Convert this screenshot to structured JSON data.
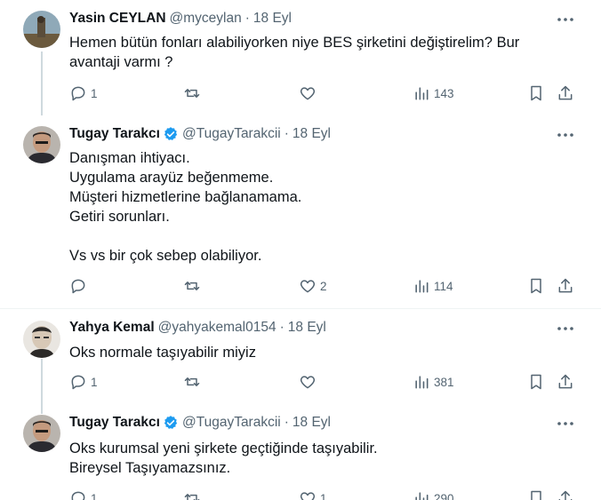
{
  "tweets": [
    {
      "name": "Yasin CEYLAN",
      "verified": false,
      "handle": "@myceylan",
      "date": "18 Eyl",
      "lines": [
        "Hemen bütün fonları alabiliyorken niye BES şirketini değiştirelim? Bur",
        "avantaji varmı ?"
      ],
      "replies": "1",
      "retweets": "",
      "likes": "",
      "views": "143"
    },
    {
      "name": "Tugay Tarakcı",
      "verified": true,
      "handle": "@TugayTarakcii",
      "date": "18 Eyl",
      "lines": [
        "Danışman ihtiyacı.",
        "Uygulama arayüz beğenmeme.",
        "Müşteri hizmetlerine bağlanamama.",
        "Getiri sorunları.",
        "",
        "Vs vs bir çok sebep olabiliyor."
      ],
      "replies": "",
      "retweets": "",
      "likes": "2",
      "views": "114"
    },
    {
      "name": "Yahya Kemal",
      "verified": false,
      "handle": "@yahyakemal0154",
      "date": "18 Eyl",
      "lines": [
        "Oks normale taşıyabilir miyiz"
      ],
      "replies": "1",
      "retweets": "",
      "likes": "",
      "views": "381"
    },
    {
      "name": "Tugay Tarakcı",
      "verified": true,
      "handle": "@TugayTarakcii",
      "date": "18 Eyl",
      "lines": [
        "Oks kurumsal yeni şirkete geçtiğinde taşıyabilir.",
        "Bireysel Taşıyamazsınız."
      ],
      "replies": "1",
      "retweets": "",
      "likes": "1",
      "views": "290"
    }
  ],
  "separator": "·",
  "colors": {
    "text": "#0f1419",
    "muted": "#536471",
    "verified": "#1d9bf0",
    "line": "#cfd9de"
  }
}
